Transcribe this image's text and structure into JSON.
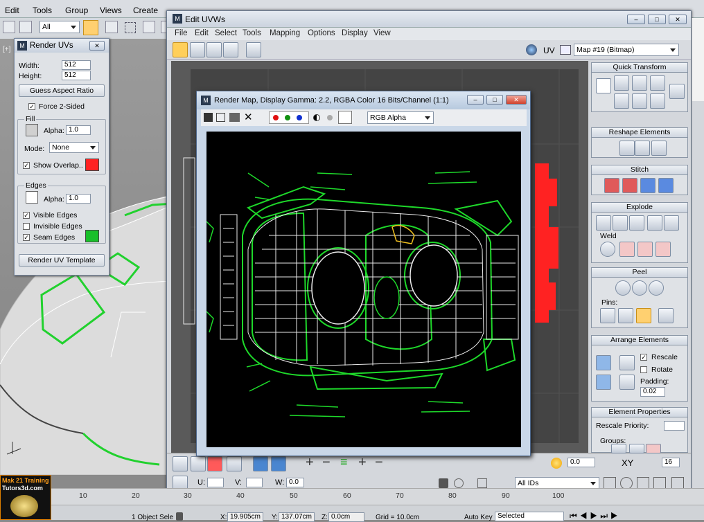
{
  "max_menu": [
    "Edit",
    "Tools",
    "Group",
    "Views",
    "Create"
  ],
  "max_toolbar": {
    "filter_value": "All"
  },
  "uvw_window": {
    "title": "Edit UVWs",
    "menu": [
      "File",
      "Edit",
      "Select",
      "Tools",
      "Mapping",
      "Options",
      "Display",
      "View"
    ],
    "uv_label": "UV",
    "map_select": "Map #19 (Bitmap)",
    "bottom": {
      "u_label": "U:",
      "v_label": "V:",
      "w_label": "W:",
      "w_value": "0.0",
      "ids_select": "All IDs",
      "zero_value": "0.0",
      "xy_label": "XY",
      "grid_value": "16"
    }
  },
  "right_panel": {
    "quick_transform": "Quick Transform",
    "reshape": "Reshape Elements",
    "stitch": "Stitch",
    "explode": "Explode",
    "weld": "Weld",
    "peel": "Peel",
    "pins": "Pins:",
    "arrange": "Arrange Elements",
    "rescale": "Rescale",
    "rotate": "Rotate",
    "padding_label": "Padding:",
    "padding_value": "0.02",
    "element_props": "Element Properties",
    "rescale_priority": "Rescale Priority:",
    "groups": "Groups:",
    "peel_bottom": "Peel"
  },
  "render_uvs": {
    "title": "Render UVs",
    "width_label": "Width:",
    "width_value": "512",
    "height_label": "Height:",
    "height_value": "512",
    "guess_btn": "Guess Aspect Ratio",
    "force2": "Force 2-Sided",
    "fill_group": "Fill",
    "alpha_label": "Alpha:",
    "fill_alpha": "1.0",
    "mode_label": "Mode:",
    "mode_value": "None",
    "show_overlap": "Show Overlap",
    "edges_group": "Edges",
    "edges_alpha": "1.0",
    "visible_edges": "Visible Edges",
    "invisible_edges": "Invisible Edges",
    "seam_edges": "Seam Edges",
    "render_btn": "Render UV Template"
  },
  "render_map": {
    "title": "Render Map, Display Gamma: 2.2, RGBA Color 16 Bits/Channel (1:1)",
    "channel_select": "RGB Alpha"
  },
  "ruler_ticks": [
    "10",
    "20",
    "30",
    "40",
    "50",
    "60",
    "70",
    "80",
    "90",
    "100"
  ],
  "status": {
    "objects": "1 Object Sele",
    "x_label": "X:",
    "x_value": "19.905cm",
    "y_label": "Y:",
    "y_value": "137.07cm",
    "z_label": "Z:",
    "z_value": "0.0cm",
    "grid": "Grid = 10.0cm",
    "autokey": "Auto Key",
    "selected": "Selected"
  },
  "logo": {
    "line1": "Mak 21 Training",
    "line2": "Tutors3d.com"
  },
  "colors": {
    "overlap": "#ff2222",
    "seam": "#19c02a",
    "wire": "#1ecf2a",
    "accent": "#ffa020"
  }
}
